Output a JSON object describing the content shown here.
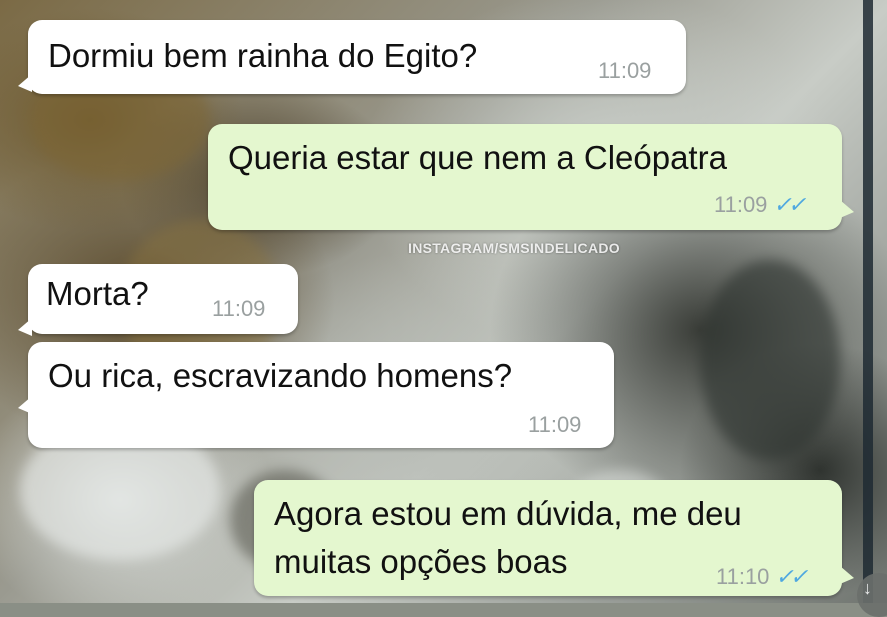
{
  "watermark": "INSTAGRAM/SMSINDELICADO",
  "messages": [
    {
      "direction": "incoming",
      "text": "Dormiu bem rainha do Egito?",
      "time": "11:09"
    },
    {
      "direction": "outgoing",
      "text": "Queria estar que nem a Cleópatra",
      "time": "11:09",
      "status": "read"
    },
    {
      "direction": "incoming",
      "text": "Morta?",
      "time": "11:09"
    },
    {
      "direction": "incoming",
      "text": "Ou rica, escravizando homens?",
      "time": "11:09"
    },
    {
      "direction": "outgoing",
      "lines": [
        "Agora estou em dúvida, me deu",
        "muitas opções boas"
      ],
      "time": "11:10",
      "status": "read"
    }
  ],
  "colors": {
    "incoming_bubble": "#ffffff",
    "outgoing_bubble": "#e4f7cf",
    "read_ticks": "#4fa8e0",
    "timestamp": "#9aa0a0"
  },
  "icons": {
    "read_status": "double-check-icon",
    "scroll_button": "scroll-down-icon"
  }
}
